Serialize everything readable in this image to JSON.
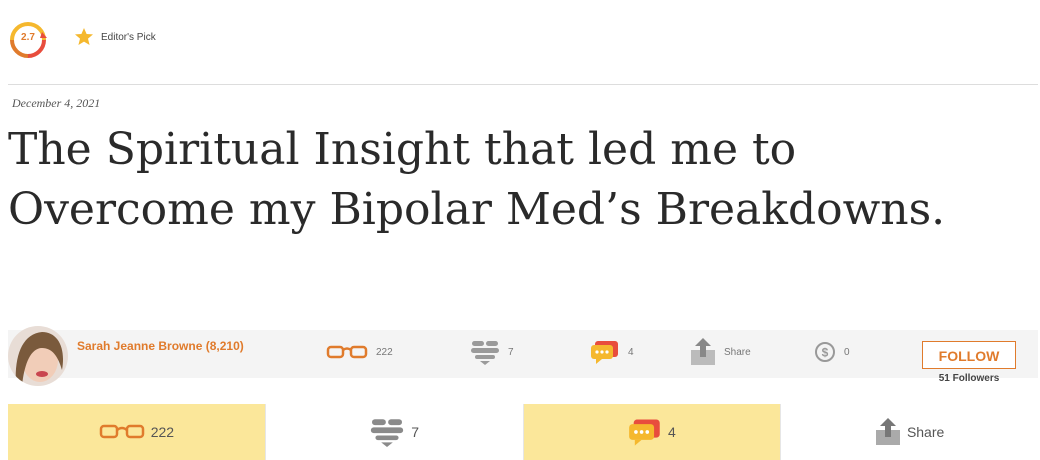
{
  "header": {
    "rating": "2.7",
    "editor_pick": "Editor's Pick"
  },
  "article": {
    "date": "December 4, 2021",
    "title": "The Spiritual Insight that led me to Overcome my Bipolar Med’s Breakdowns."
  },
  "author": {
    "name": "Sarah Jeanne Browne (8,210)",
    "follow_label": "FOLLOW",
    "followers": "51 Followers"
  },
  "stats": {
    "reads": "222",
    "likes": "7",
    "comments": "4",
    "share": "Share",
    "tips": "0"
  },
  "actions": {
    "reads": "222",
    "likes": "7",
    "comments": "4",
    "share": "Share"
  },
  "colors": {
    "accent": "#e07b2c",
    "highlight": "#fbe79a",
    "comment_red": "#e84d3d",
    "comment_yellow": "#f5b82e"
  }
}
